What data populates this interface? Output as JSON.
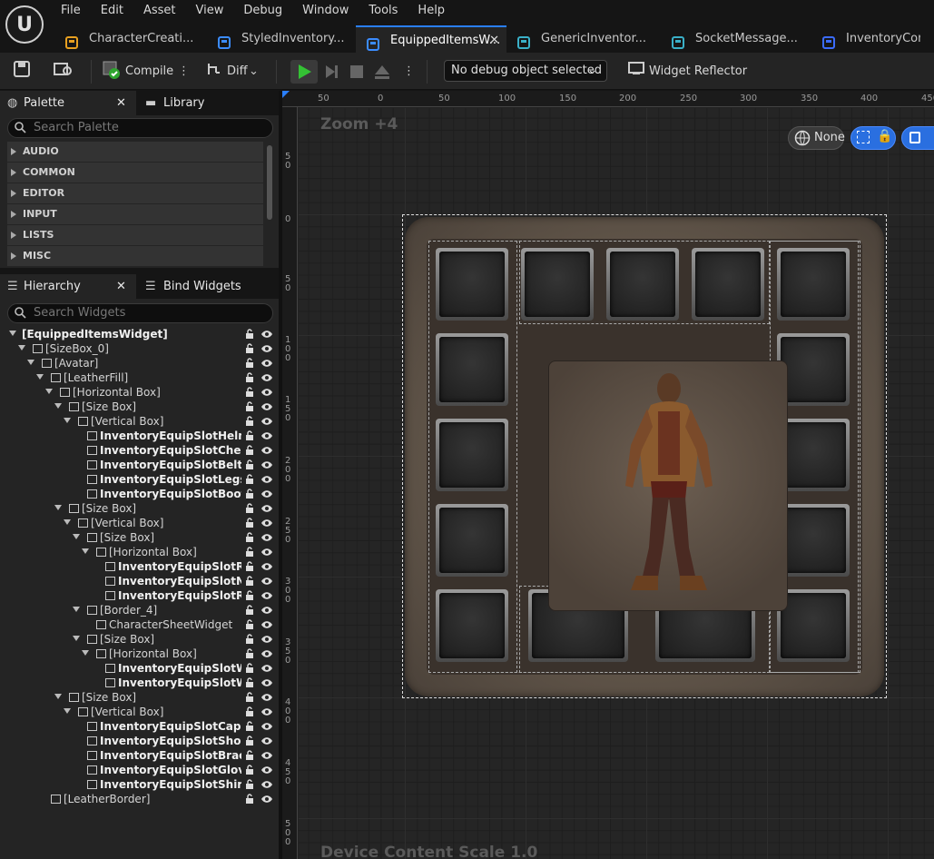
{
  "menu": {
    "items": [
      "File",
      "Edit",
      "Asset",
      "View",
      "Debug",
      "Window",
      "Tools",
      "Help"
    ]
  },
  "tabs": [
    {
      "label": "CharacterCreati...",
      "icon": "blueprint-character-icon",
      "color": "#e8a020"
    },
    {
      "label": "StyledInventory...",
      "icon": "widget-blueprint-icon",
      "color": "#3b8cff"
    },
    {
      "label": "EquippedItemsW...",
      "icon": "widget-blueprint-icon",
      "color": "#3b8cff",
      "active": true
    },
    {
      "label": "GenericInventor...",
      "icon": "component-icon",
      "color": "#3ab0c8"
    },
    {
      "label": "SocketMessage...",
      "icon": "struct-icon",
      "color": "#3ab0c8"
    },
    {
      "label": "InventoryCompo",
      "icon": "component-icon",
      "color": "#3b6cff"
    }
  ],
  "toolbar": {
    "compile": "Compile",
    "diff": "Diff",
    "debug_object": "No debug object selected",
    "widget_reflector": "Widget Reflector"
  },
  "palette": {
    "tab": "Palette",
    "library_tab": "Library",
    "search_placeholder": "Search Palette",
    "categories": [
      "AUDIO",
      "COMMON",
      "EDITOR",
      "INPUT",
      "LISTS",
      "MISC"
    ]
  },
  "hierarchy": {
    "tab": "Hierarchy",
    "bind_tab": "Bind Widgets",
    "search_placeholder": "Search Widgets",
    "rows": [
      {
        "label": "[EquippedItemsWidget]",
        "depth": 0,
        "exp": true,
        "bold": true,
        "icon": false
      },
      {
        "label": "[SizeBox_0]",
        "depth": 1,
        "exp": true,
        "icon": true
      },
      {
        "label": "[Avatar]",
        "depth": 2,
        "exp": true,
        "icon": true
      },
      {
        "label": "[LeatherFill]",
        "depth": 3,
        "exp": true,
        "icon": true
      },
      {
        "label": "[Horizontal Box]",
        "depth": 4,
        "exp": true,
        "icon": true
      },
      {
        "label": "[Size Box]",
        "depth": 5,
        "exp": true,
        "icon": true
      },
      {
        "label": "[Vertical Box]",
        "depth": 6,
        "exp": true,
        "icon": true
      },
      {
        "label": "InventoryEquipSlotHelm",
        "depth": 7,
        "bold": true,
        "icon": true
      },
      {
        "label": "InventoryEquipSlotChest",
        "depth": 7,
        "bold": true,
        "icon": true
      },
      {
        "label": "InventoryEquipSlotBelt",
        "depth": 7,
        "bold": true,
        "icon": true
      },
      {
        "label": "InventoryEquipSlotLegs",
        "depth": 7,
        "bold": true,
        "icon": true
      },
      {
        "label": "InventoryEquipSlotBoots",
        "depth": 7,
        "bold": true,
        "icon": true
      },
      {
        "label": "[Size Box]",
        "depth": 5,
        "exp": true,
        "icon": true
      },
      {
        "label": "[Vertical Box]",
        "depth": 6,
        "exp": true,
        "icon": true
      },
      {
        "label": "[Size Box]",
        "depth": 7,
        "exp": true,
        "icon": true
      },
      {
        "label": "[Horizontal Box]",
        "depth": 8,
        "exp": true,
        "icon": true
      },
      {
        "label": "InventoryEquipSlotRing",
        "depth": 9,
        "bold": true,
        "icon": true
      },
      {
        "label": "InventoryEquipSlotNeck",
        "depth": 9,
        "bold": true,
        "icon": true
      },
      {
        "label": "InventoryEquipSlotRing",
        "depth": 9,
        "bold": true,
        "icon": true
      },
      {
        "label": "[Border_4]",
        "depth": 7,
        "exp": true,
        "icon": true
      },
      {
        "label": "CharacterSheetWidget",
        "depth": 8,
        "icon": true
      },
      {
        "label": "[Size Box]",
        "depth": 7,
        "exp": true,
        "icon": true
      },
      {
        "label": "[Horizontal Box]",
        "depth": 8,
        "exp": true,
        "icon": true
      },
      {
        "label": "InventoryEquipSlotWea",
        "depth": 9,
        "bold": true,
        "icon": true
      },
      {
        "label": "InventoryEquipSlotWea",
        "depth": 9,
        "bold": true,
        "icon": true
      },
      {
        "label": "[Size Box]",
        "depth": 5,
        "exp": true,
        "icon": true
      },
      {
        "label": "[Vertical Box]",
        "depth": 6,
        "exp": true,
        "icon": true
      },
      {
        "label": "InventoryEquipSlotCape",
        "depth": 7,
        "bold": true,
        "icon": true
      },
      {
        "label": "InventoryEquipSlotShoulde",
        "depth": 7,
        "bold": true,
        "icon": true
      },
      {
        "label": "InventoryEquipSlotBracers",
        "depth": 7,
        "bold": true,
        "icon": true
      },
      {
        "label": "InventoryEquipSlotGloves",
        "depth": 7,
        "bold": true,
        "icon": true
      },
      {
        "label": "InventoryEquipSlotShirt",
        "depth": 7,
        "bold": true,
        "icon": true
      },
      {
        "label": "[LeatherBorder]",
        "depth": 3,
        "icon": true
      }
    ]
  },
  "designer": {
    "zoom": "Zoom +4",
    "device_scale": "Device Content Scale 1.0",
    "none_label": "None",
    "ruler_top": [
      "50",
      "0",
      "50",
      "100",
      "150",
      "200",
      "250",
      "300",
      "350",
      "400",
      "450"
    ],
    "ruler_left": [
      "50",
      "0",
      "50",
      "100",
      "150",
      "200",
      "250",
      "300",
      "350",
      "400",
      "450",
      "500"
    ]
  }
}
